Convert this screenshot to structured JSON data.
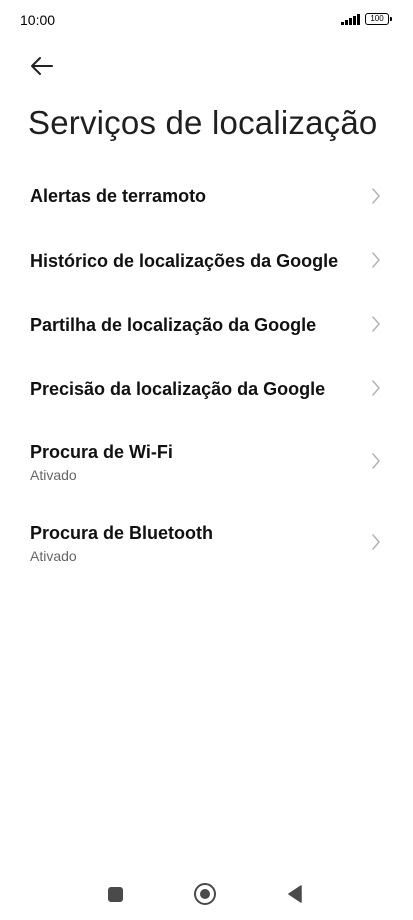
{
  "status_bar": {
    "time": "10:00",
    "signal_icon": "signal-bars-icon",
    "battery_level": "100"
  },
  "header": {
    "back_icon": "arrow-left-icon",
    "title": "Serviços de localização"
  },
  "items": [
    {
      "title": "Alertas de terramoto",
      "subtitle": ""
    },
    {
      "title": "Histórico de localizações da Google",
      "subtitle": ""
    },
    {
      "title": "Partilha de localização da Google",
      "subtitle": ""
    },
    {
      "title": "Precisão da localização da Google",
      "subtitle": ""
    },
    {
      "title": "Procura de Wi-Fi",
      "subtitle": "Ativado"
    },
    {
      "title": "Procura de Bluetooth",
      "subtitle": "Ativado"
    }
  ],
  "nav_bar": {
    "recents_icon": "square-icon",
    "home_icon": "circle-icon",
    "back_icon": "triangle-left-icon"
  },
  "colors": {
    "background": "#ffffff",
    "text_primary": "#111111",
    "text_secondary": "#666666",
    "chevron": "#b3b3b3",
    "nav_icons": "#4a4a4a"
  }
}
